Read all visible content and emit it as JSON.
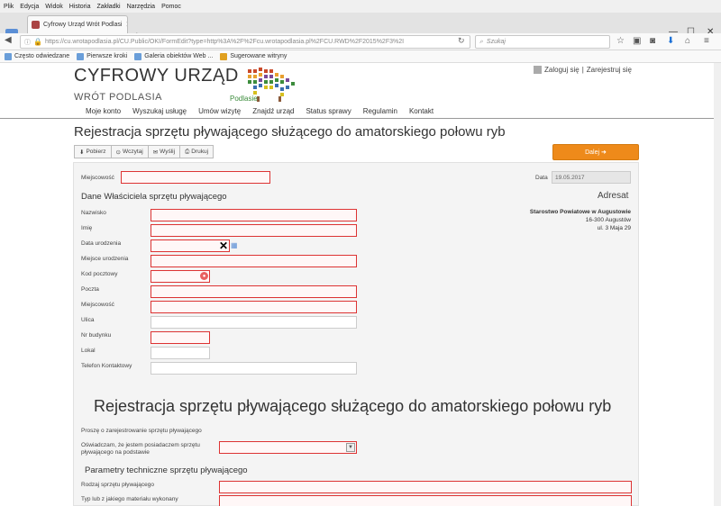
{
  "menu": [
    "Plik",
    "Edycja",
    "Widok",
    "Historia",
    "Zakładki",
    "Narzędzia",
    "Pomoc"
  ],
  "tab": {
    "title": "Cyfrowy Urząd Wrót Podlasi"
  },
  "url": {
    "full": "https://cu.wrotapodlasia.pl/CU.Public/OKI/FormEdit?type=http%3A%2F%2Fcu.wrotapodlasia.pl%2FCU.RWD%2F2015%2F3%2I"
  },
  "search": {
    "placeholder": "Szukaj"
  },
  "bookmarks": [
    "Często odwiedzane",
    "Pierwsze kroki",
    "Galeria obiektów Web ...",
    "Sugerowane witryny"
  ],
  "site": {
    "title": "CYFROWY URZĄD",
    "subtitle": "WRÓT PODLASIA",
    "logo_text": "Podlasie"
  },
  "auth": {
    "login": "Zaloguj się",
    "separator": "|",
    "register": "Zarejestruj się"
  },
  "nav": [
    "Moje konto",
    "Wyszukaj usługę",
    "Umów wizytę",
    "Znajdź urząd",
    "Status sprawy",
    "Regulamin",
    "Kontakt"
  ],
  "page": {
    "title": "Rejestracja sprzętu pływającego służącego do amatorskiego połowu ryb"
  },
  "toolbar": {
    "download": "Pobierz",
    "load": "Wczytaj",
    "send": "Wyślij",
    "print": "Drukuj",
    "next": "Dalej ➜"
  },
  "form": {
    "city_label": "Miejscowość",
    "date_label": "Data",
    "date_value": "19.05.2017",
    "owner_section": "Dane Właściciela sprzętu pływającego",
    "address_header": "Adresat",
    "address": {
      "name": "Starostwo Powiatowe w Augustowie",
      "city": "16-300 Augustów",
      "street": "ul. 3 Maja 29"
    },
    "fields": [
      "Nazwisko",
      "Imię",
      "Data urodzenia",
      "Miejsce urodzenia",
      "Kod pocztowy",
      "Poczta",
      "Miejscowość",
      "Ulica",
      "Nr budynku",
      "Lokal",
      "Telefon Kontaktowy"
    ],
    "big_title": "Rejestracja sprzętu pływającego służącego do amatorskiego połowu ryb",
    "request_text": "Proszę o zarejestrowanie sprzętu pływającego",
    "declare_text_1": "Oświadczam, że jestem posiadaczem sprzętu",
    "declare_text_2": "pływającego na podstawie",
    "tech_section": "Parametry techniczne sprzętu pływającego",
    "type_label": "Rodzaj sprzętu pływającego",
    "material_label": "Typ lub z jakiego materiału wykonany"
  }
}
